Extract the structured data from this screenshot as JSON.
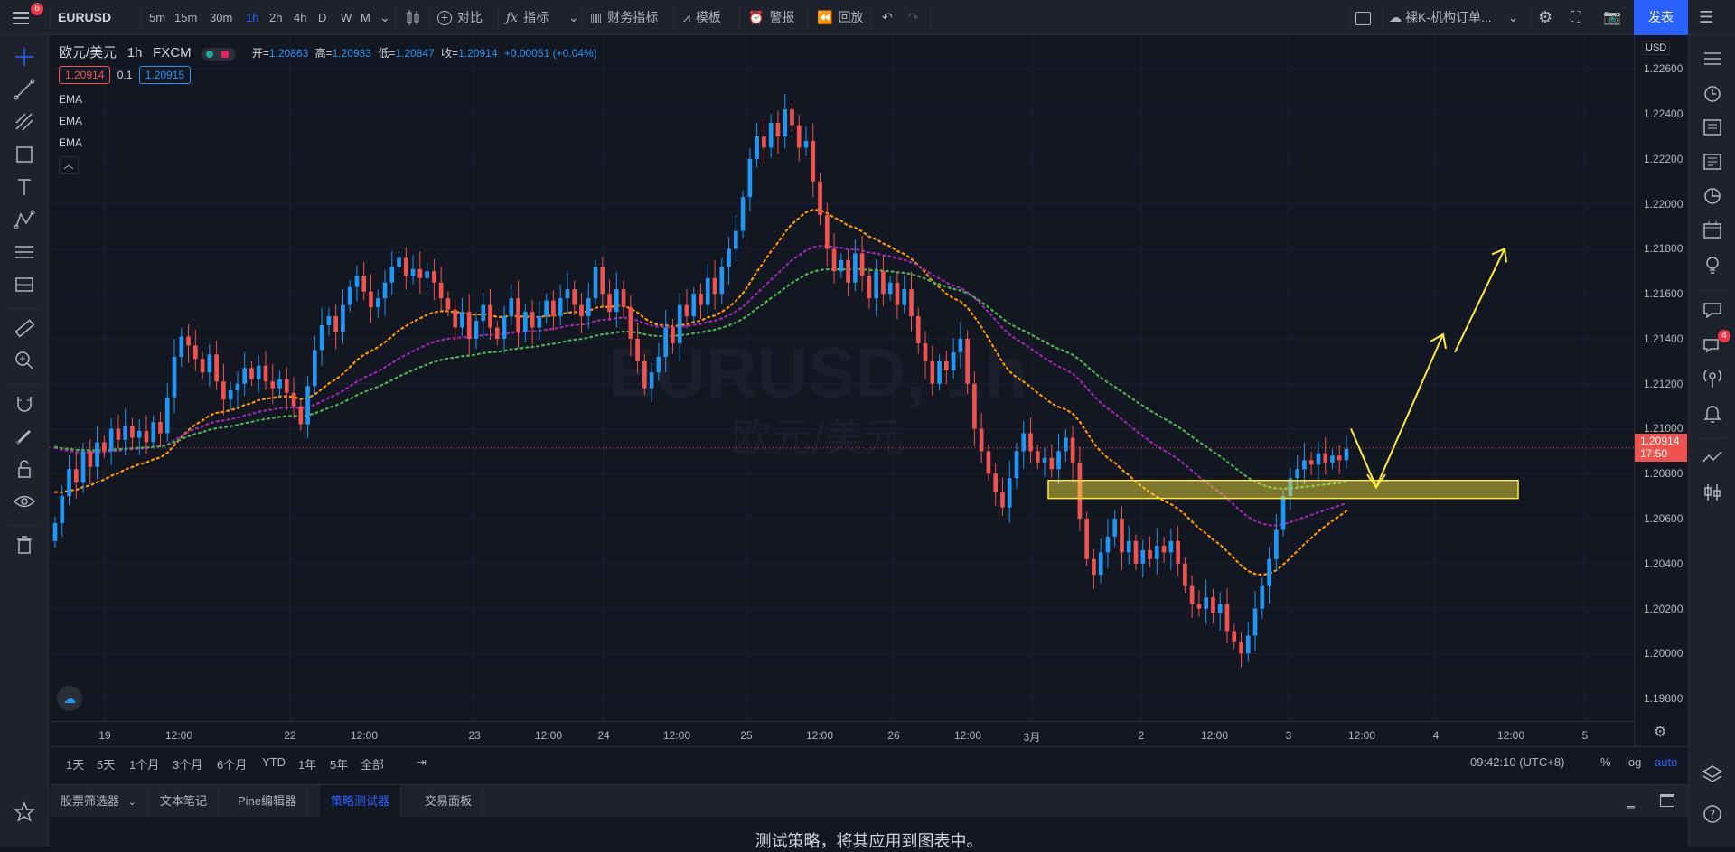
{
  "topbar": {
    "notification_count": "6",
    "symbol": "EURUSD",
    "intervals": [
      "5m",
      "15m",
      "30m",
      "1h",
      "2h",
      "4h",
      "D",
      "W",
      "M"
    ],
    "active_interval": "1h",
    "compare_label": "对比",
    "indicators_label": "指标",
    "financials_label": "财务指标",
    "templates_label": "模板",
    "alert_label": "警报",
    "replay_label": "回放",
    "layout_name": "裸K-机构订单...",
    "publish_label": "发表"
  },
  "legend": {
    "title": "欧元/美元",
    "interval": "1h",
    "exchange": "FXCM",
    "open_label": "开=",
    "open": "1.20863",
    "high_label": "高=",
    "high": "1.20933",
    "low_label": "低=",
    "low": "1.20847",
    "close_label": "收=",
    "close": "1.20914",
    "change": "+0.00051 (+0.04%)",
    "sell_price": "1.20914",
    "spread": "0.1",
    "buy_price": "1.20915",
    "indicators": [
      "EMA",
      "EMA",
      "EMA"
    ]
  },
  "watermark": {
    "symbol": "EURUSD, 1h",
    "description": "欧元/美元"
  },
  "price_axis": {
    "currency": "USD",
    "ticks": [
      "1.22600",
      "1.22400",
      "1.22200",
      "1.22000",
      "1.21800",
      "1.21600",
      "1.21400",
      "1.21200",
      "1.21000",
      "1.20800",
      "1.20600",
      "1.20400",
      "1.20200",
      "1.20000",
      "1.19800"
    ],
    "last_price": "1.20914",
    "countdown": "17:50"
  },
  "time_axis": {
    "labels": [
      "19",
      "12:00",
      "22",
      "12:00",
      "23",
      "12:00",
      "24",
      "12:00",
      "25",
      "12:00",
      "26",
      "12:00",
      "3月",
      "2",
      "12:00",
      "3",
      "12:00",
      "4",
      "12:00",
      "5"
    ]
  },
  "range_bar": {
    "ranges": [
      "1天",
      "5天",
      "1个月",
      "3个月",
      "6个月",
      "YTD",
      "1年",
      "5年",
      "全部"
    ],
    "clock": "09:42:10 (UTC+8)",
    "percent_label": "%",
    "log_label": "log",
    "auto_label": "auto"
  },
  "bottom_tabs": {
    "tabs": [
      "股票筛选器",
      "文本笔记",
      "Pine编辑器",
      "策略测试器",
      "交易面板"
    ],
    "active": "策略测试器"
  },
  "bottom_panel": {
    "message": "测试策略，将其应用到图表中。"
  },
  "rightbar": {
    "badge": "4"
  },
  "colors": {
    "background": "#131722",
    "panel": "#1e222d",
    "up": "#2196f3",
    "down": "#ef5350",
    "ema_fast": "#ff9800",
    "ema_mid": "#9c27b0",
    "ema_slow": "#4caf50",
    "accent": "#2962ff",
    "zone": "#ffeb3b"
  },
  "chart_data": {
    "type": "candlestick",
    "price_min": 1.197,
    "price_max": 1.2275,
    "last_price": 1.20914,
    "support_zone": [
      1.2069,
      1.2077
    ],
    "closes": [
      1.2058,
      1.207,
      1.2082,
      1.2076,
      1.209,
      1.2083,
      1.2094,
      1.209,
      1.21,
      1.2095,
      1.2101,
      1.2096,
      1.2099,
      1.2094,
      1.2103,
      1.2098,
      1.2114,
      1.2132,
      1.2141,
      1.2137,
      1.2131,
      1.2125,
      1.2133,
      1.2121,
      1.2113,
      1.2117,
      1.212,
      1.2127,
      1.2122,
      1.2128,
      1.2121,
      1.2118,
      1.2122,
      1.2116,
      1.211,
      1.2102,
      1.2119,
      1.2135,
      1.2146,
      1.215,
      1.2143,
      1.2155,
      1.2163,
      1.2168,
      1.2161,
      1.2154,
      1.2158,
      1.2165,
      1.2172,
      1.2176,
      1.2168,
      1.2171,
      1.2167,
      1.217,
      1.2165,
      1.2158,
      1.2153,
      1.2145,
      1.2152,
      1.214,
      1.2148,
      1.2155,
      1.2145,
      1.214,
      1.215,
      1.2158,
      1.2143,
      1.2152,
      1.2145,
      1.215,
      1.2157,
      1.215,
      1.2158,
      1.2162,
      1.2155,
      1.215,
      1.2158,
      1.2172,
      1.216,
      1.2152,
      1.2162,
      1.2154,
      1.214,
      1.213,
      1.2118,
      1.2125,
      1.2132,
      1.2145,
      1.2138,
      1.2155,
      1.215,
      1.216,
      1.2155,
      1.2167,
      1.216,
      1.2172,
      1.218,
      1.2188,
      1.2203,
      1.222,
      1.223,
      1.2225,
      1.2236,
      1.223,
      1.2242,
      1.2235,
      1.2225,
      1.2228,
      1.221,
      1.2195,
      1.218,
      1.217,
      1.2175,
      1.2165,
      1.2178,
      1.2168,
      1.2158,
      1.217,
      1.216,
      1.2165,
      1.2155,
      1.2162,
      1.215,
      1.2138,
      1.213,
      1.212,
      1.213,
      1.2126,
      1.2134,
      1.214,
      1.212,
      1.21,
      1.209,
      1.208,
      1.2072,
      1.2065,
      1.2078,
      1.209,
      1.2098,
      1.209,
      1.2085,
      1.2087,
      1.2082,
      1.209,
      1.2096,
      1.2085,
      1.206,
      1.2042,
      1.2035,
      1.2045,
      1.2052,
      1.206,
      1.2045,
      1.205,
      1.204,
      1.2046,
      1.2042,
      1.2048,
      1.2045,
      1.205,
      1.204,
      1.203,
      1.2022,
      1.202,
      1.2025,
      1.2018,
      1.2022,
      1.201,
      1.2005,
      1.2,
      1.2008,
      1.202,
      1.203,
      1.2042,
      1.2055,
      1.207,
      1.2078,
      1.2082,
      1.2086,
      1.2084,
      1.2089,
      1.2085,
      1.2088,
      1.2086,
      1.2091
    ]
  }
}
